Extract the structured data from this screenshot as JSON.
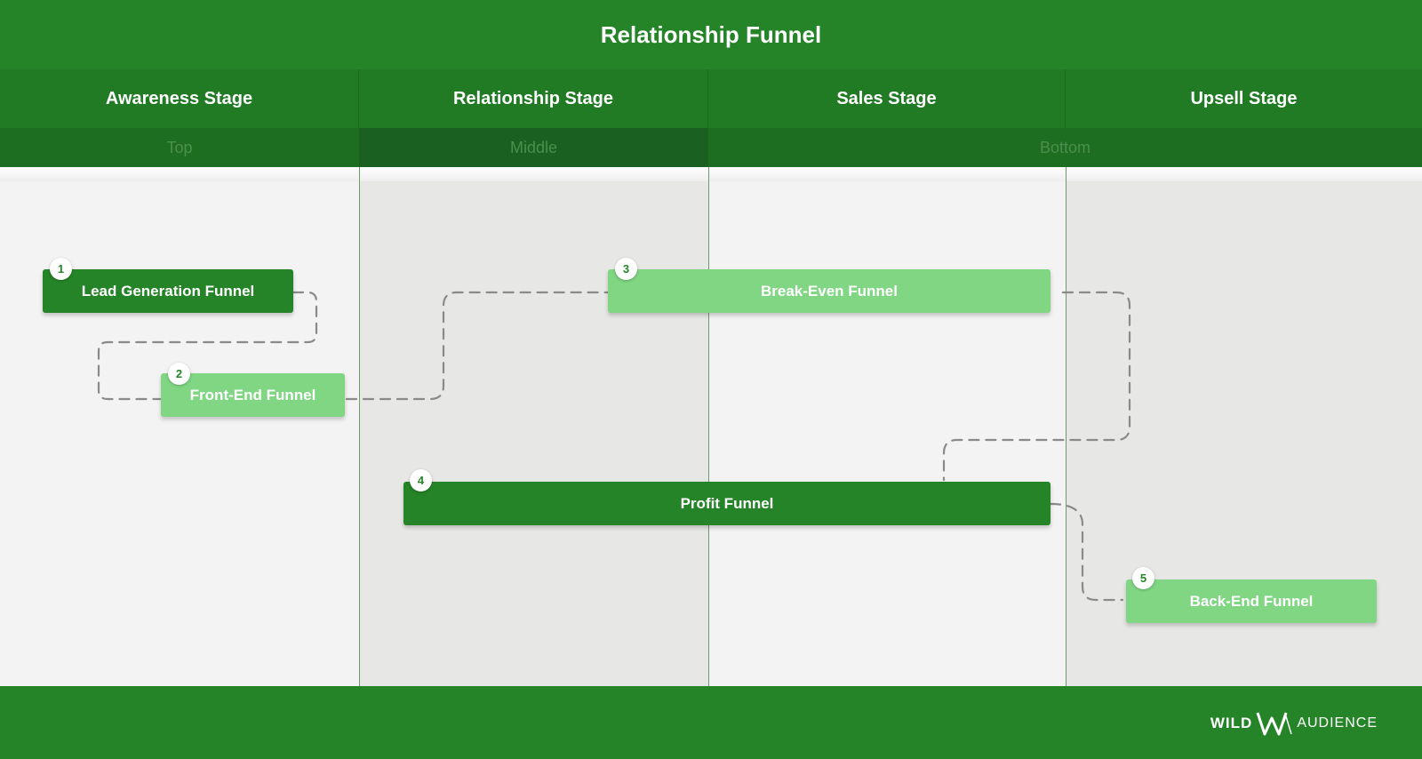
{
  "title": "Relationship Funnel",
  "stages": [
    "Awareness Stage",
    "Relationship Stage",
    "Sales Stage",
    "Upsell Stage"
  ],
  "levels": [
    "Top",
    "Middle",
    "Bottom"
  ],
  "funnels": [
    {
      "number": "1",
      "label": "Lead Generation Funnel",
      "style": "dark"
    },
    {
      "number": "2",
      "label": "Front-End Funnel",
      "style": "light"
    },
    {
      "number": "3",
      "label": "Break-Even Funnel",
      "style": "light"
    },
    {
      "number": "4",
      "label": "Profit Funnel",
      "style": "dark"
    },
    {
      "number": "5",
      "label": "Back-End Funnel",
      "style": "light"
    }
  ],
  "logo": {
    "left": "WILD",
    "right": "AUDIENCE"
  },
  "colors": {
    "primary": "#258427",
    "light": "#80d683",
    "connector": "#8a8a8a"
  }
}
